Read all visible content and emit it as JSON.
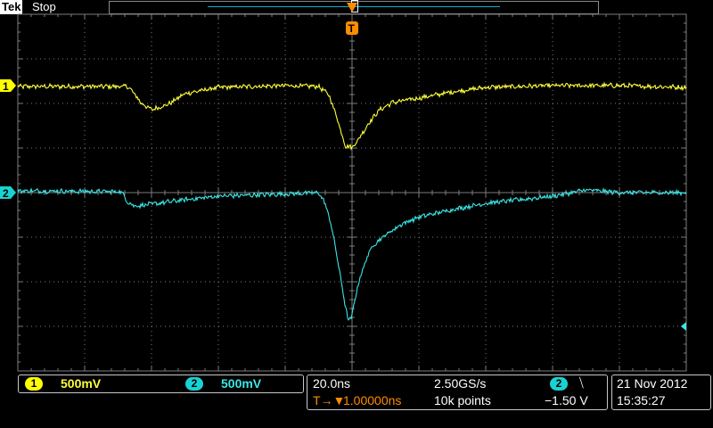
{
  "header": {
    "brand": "Tek",
    "run_state": "Stop",
    "trigger_marker_label": "T"
  },
  "channels": [
    {
      "id": "1",
      "label": "1",
      "scale": "500mV",
      "color": "#ffff3c",
      "badge_color": "#ffff00"
    },
    {
      "id": "2",
      "label": "2",
      "scale": "500mV",
      "color": "#3ce6e6",
      "badge_color": "#19d2d2"
    }
  ],
  "timebase": {
    "time_per_div": "20.0ns",
    "sample_rate": "2.50GS/s",
    "trigger_delay": "1.00000ns",
    "trigger_delay_prefix": "T→▼",
    "record_length": "10k points"
  },
  "trigger": {
    "source": "2",
    "slope_symbol": "⧹",
    "slope_name": "falling-edge",
    "level": "−1.50 V"
  },
  "datetime": {
    "date": "21 Nov 2012",
    "time": "15:35:27"
  },
  "colors": {
    "grid": "#7d7d7d",
    "ch1": "#ffff3c",
    "ch2": "#3ce6e6",
    "trigger": "#ff8c00"
  },
  "chart_data": {
    "type": "line",
    "title": "",
    "xlabel": "",
    "ylabel": "",
    "x_unit": "ns",
    "x_range": [
      -100,
      100
    ],
    "y_unit": "divisions",
    "y_range": [
      -4,
      4
    ],
    "grid": true,
    "series": [
      {
        "name": "1",
        "x": [
          -100,
          -67,
          -65,
          -63,
          -60,
          -55,
          -50,
          -40,
          -20,
          -10,
          -7,
          -5,
          -3,
          -2,
          0,
          1,
          3,
          5,
          8,
          12,
          20,
          30,
          40,
          60,
          80,
          100
        ],
        "y": [
          2.38,
          2.38,
          2.2,
          2.0,
          1.86,
          1.98,
          2.22,
          2.36,
          2.4,
          2.38,
          2.2,
          1.8,
          1.3,
          1.05,
          1.02,
          1.1,
          1.32,
          1.56,
          1.84,
          2.02,
          2.12,
          2.26,
          2.36,
          2.4,
          2.4,
          2.36
        ]
      },
      {
        "name": "2",
        "x": [
          -100,
          -69,
          -67,
          -65,
          -60,
          -50,
          -40,
          -20,
          -10,
          -8,
          -6,
          -4,
          -2,
          -1,
          0,
          1,
          2,
          4,
          6,
          10,
          15,
          20,
          30,
          40,
          60,
          70,
          80,
          100
        ],
        "y": [
          0.04,
          0.02,
          -0.22,
          -0.3,
          -0.26,
          -0.16,
          -0.08,
          -0.03,
          0.0,
          -0.25,
          -0.8,
          -1.65,
          -2.55,
          -2.9,
          -2.75,
          -2.35,
          -2.0,
          -1.55,
          -1.2,
          -0.95,
          -0.7,
          -0.55,
          -0.38,
          -0.24,
          -0.08,
          0.06,
          0.0,
          0.0
        ]
      }
    ]
  }
}
